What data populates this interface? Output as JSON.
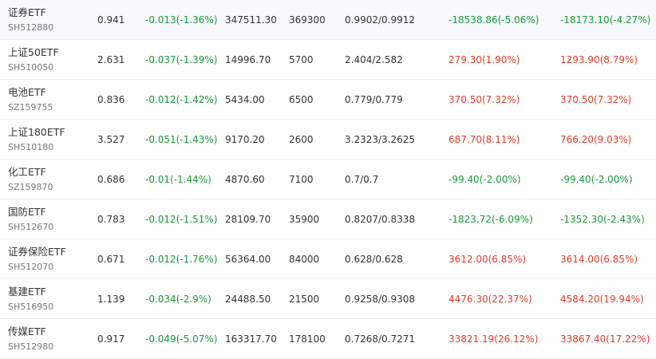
{
  "colors": {
    "up": "#e23b2b",
    "down": "#1a9a3a",
    "text": "#333333",
    "subtext": "#777777",
    "divider": "#ececec"
  },
  "rows": [
    {
      "name": "证券ETF",
      "code": "SH512880",
      "price": "0.941",
      "change": "-0.013(-1.36%)",
      "change_dir": "down",
      "amount": "347511.30",
      "volume": "369300",
      "range": "0.9902/0.9912",
      "flow1": "-18538.86(-5.06%)",
      "flow1_dir": "down",
      "flow2": "-18173.10(-4.27%)",
      "flow2_dir": "down"
    },
    {
      "name": "上证50ETF",
      "code": "SH510050",
      "price": "2.631",
      "change": "-0.037(-1.39%)",
      "change_dir": "down",
      "amount": "14996.70",
      "volume": "5700",
      "range": "2.404/2.582",
      "flow1": "279.30(1.90%)",
      "flow1_dir": "up",
      "flow2": "1293.90(8.79%)",
      "flow2_dir": "up"
    },
    {
      "name": "电池ETF",
      "code": "SZ159755",
      "price": "0.836",
      "change": "-0.012(-1.42%)",
      "change_dir": "down",
      "amount": "5434.00",
      "volume": "6500",
      "range": "0.779/0.779",
      "flow1": "370.50(7.32%)",
      "flow1_dir": "up",
      "flow2": "370.50(7.32%)",
      "flow2_dir": "up"
    },
    {
      "name": "上证180ETF",
      "code": "SH510180",
      "price": "3.527",
      "change": "-0.051(-1.43%)",
      "change_dir": "down",
      "amount": "9170.20",
      "volume": "2600",
      "range": "3.2323/3.2625",
      "flow1": "687.70(8.11%)",
      "flow1_dir": "up",
      "flow2": "766.20(9.03%)",
      "flow2_dir": "up"
    },
    {
      "name": "化工ETF",
      "code": "SZ159870",
      "price": "0.686",
      "change": "-0.01(-1.44%)",
      "change_dir": "down",
      "amount": "4870.60",
      "volume": "7100",
      "range": "0.7/0.7",
      "flow1": "-99.40(-2.00%)",
      "flow1_dir": "down",
      "flow2": "-99.40(-2.00%)",
      "flow2_dir": "down"
    },
    {
      "name": "国防ETF",
      "code": "SH512670",
      "price": "0.783",
      "change": "-0.012(-1.51%)",
      "change_dir": "down",
      "amount": "28109.70",
      "volume": "35900",
      "range": "0.8207/0.8338",
      "flow1": "-1823.72(-6.09%)",
      "flow1_dir": "down",
      "flow2": "-1352.30(-2.43%)",
      "flow2_dir": "down"
    },
    {
      "name": "证券保险ETF",
      "code": "SH512070",
      "price": "0.671",
      "change": "-0.012(-1.76%)",
      "change_dir": "down",
      "amount": "56364.00",
      "volume": "84000",
      "range": "0.628/0.628",
      "flow1": "3612.00(6.85%)",
      "flow1_dir": "up",
      "flow2": "3614.00(6.85%)",
      "flow2_dir": "up"
    },
    {
      "name": "基建ETF",
      "code": "SH516950",
      "price": "1.139",
      "change": "-0.034(-2.9%)",
      "change_dir": "down",
      "amount": "24488.50",
      "volume": "21500",
      "range": "0.9258/0.9308",
      "flow1": "4476.30(22.37%)",
      "flow1_dir": "up",
      "flow2": "4584.20(19.94%)",
      "flow2_dir": "up"
    },
    {
      "name": "传媒ETF",
      "code": "SH512980",
      "price": "0.917",
      "change": "-0.049(-5.07%)",
      "change_dir": "down",
      "amount": "163317.70",
      "volume": "178100",
      "range": "0.7268/0.7271",
      "flow1": "33821.19(26.12%)",
      "flow1_dir": "up",
      "flow2": "33867.40(17.22%)",
      "flow2_dir": "up"
    }
  ]
}
